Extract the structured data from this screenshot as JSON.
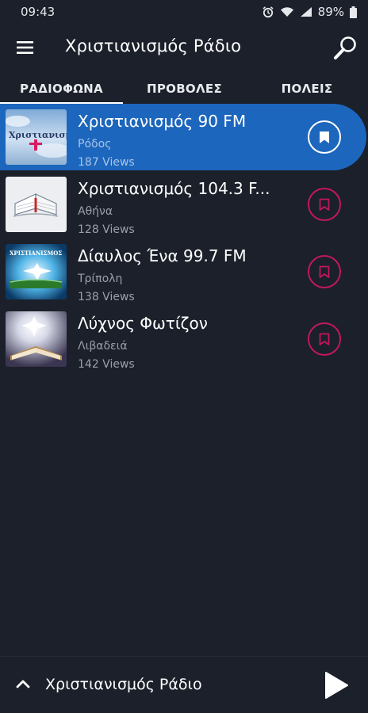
{
  "status_bar": {
    "time": "09:43",
    "battery": "89%",
    "icons": [
      "alarm-icon",
      "wifi-icon",
      "signal-icon",
      "battery-icon"
    ]
  },
  "app_bar": {
    "title": "Χριστιανισμός Ράδιο",
    "menu_icon": "hamburger-menu-icon",
    "search_icon": "search-icon"
  },
  "tabs": [
    {
      "label": "ΡΑΔΙΟΦΩΝΑ",
      "selected": true
    },
    {
      "label": "ΠΡΟΒΟΛΕΣ",
      "selected": false
    },
    {
      "label": "ΠΟΛΕΙΣ",
      "selected": false
    }
  ],
  "stations": [
    {
      "name": "Χριστιανισμός 90 FM",
      "city": "Ρόδος",
      "views": "187 Views",
      "active": true,
      "bookmarked": true,
      "thumb_text": "Χριστιανισμός"
    },
    {
      "name": "Χριστιανισμός 104.3 F...",
      "city": "Αθήνα",
      "views": "128 Views",
      "active": false,
      "bookmarked": false
    },
    {
      "name": "Δίαυλος Ένα 99.7 FM",
      "city": "Τρίπολη",
      "views": "138 Views",
      "active": false,
      "bookmarked": false,
      "thumb_text": "ΧΡΙΣΤΙΑΝΙΣΜΟΣ"
    },
    {
      "name": "Λύχνος Φωτίζον",
      "city": "Λιβαδειά",
      "views": "142 Views",
      "active": false,
      "bookmarked": false
    }
  ],
  "player": {
    "title": "Χριστιανισμός Ράδιο",
    "expand_icon": "chevron-up-icon",
    "play_icon": "play-icon"
  },
  "colors": {
    "background": "#1b202a",
    "active_row": "#1c66bd",
    "bookmark_ring": "#c2185b",
    "muted_text": "#9aa0aa"
  }
}
